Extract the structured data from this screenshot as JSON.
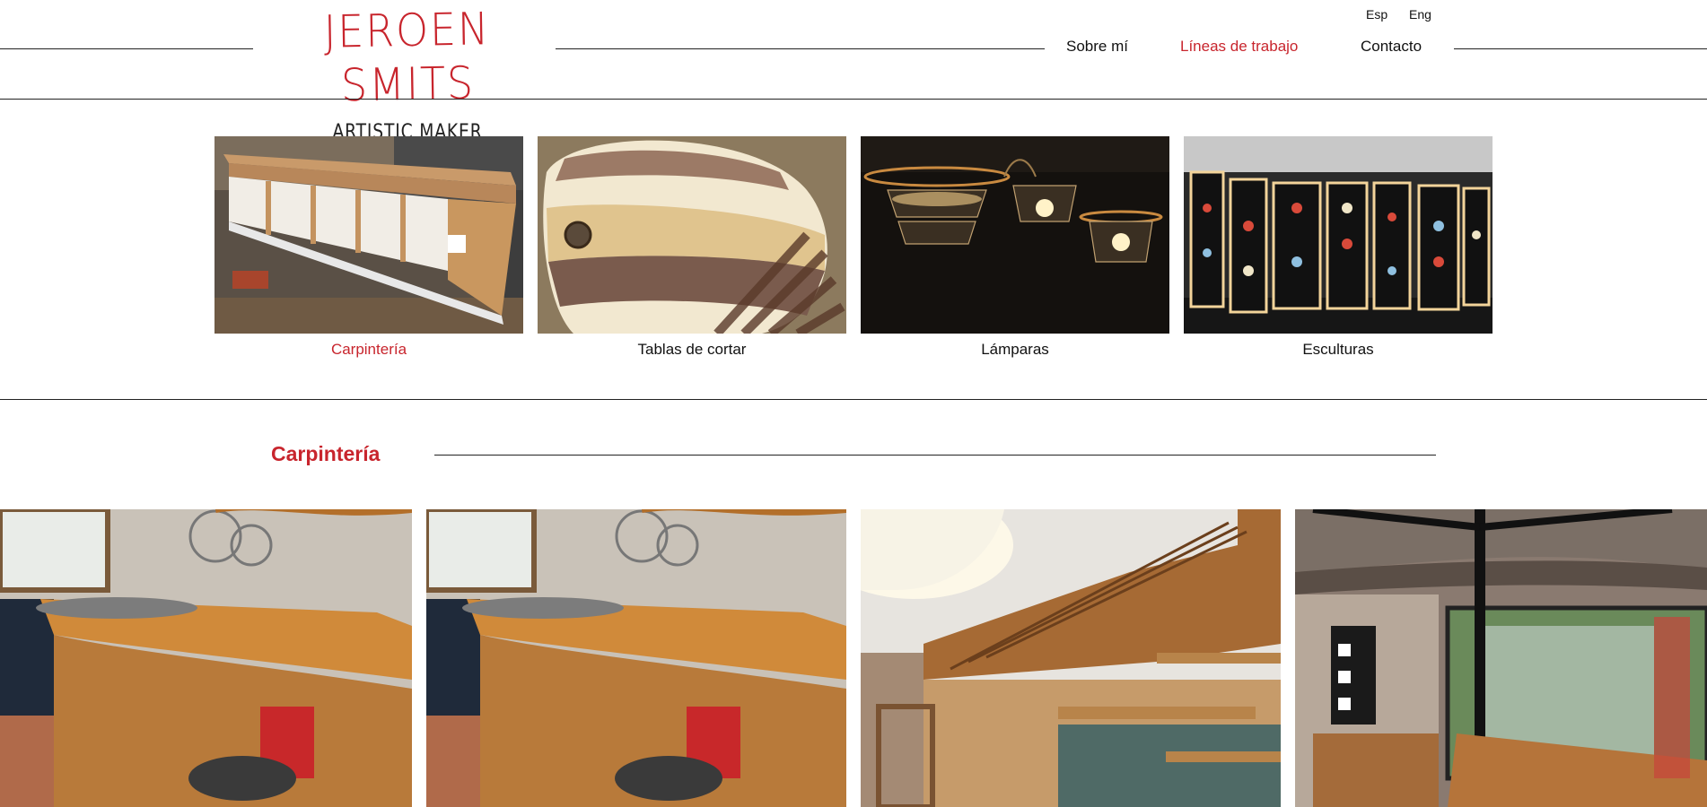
{
  "header": {
    "logo_title": "JEROEN SMITS",
    "logo_subtitle": "ARTISTIC MAKER",
    "languages": [
      {
        "label": "Esp"
      },
      {
        "label": "Eng"
      }
    ],
    "nav": [
      {
        "label": "Sobre mí",
        "active": false
      },
      {
        "label": "Líneas de trabajo",
        "active": true
      },
      {
        "label": "Contacto",
        "active": false
      }
    ]
  },
  "categories": [
    {
      "label": "Carpintería",
      "active": true
    },
    {
      "label": "Tablas de cortar",
      "active": false
    },
    {
      "label": "Lámparas",
      "active": false
    },
    {
      "label": "Esculturas",
      "active": false
    }
  ],
  "section": {
    "title": "Carpintería"
  },
  "colors": {
    "accent": "#c8252d",
    "text": "#111111",
    "line": "#222222",
    "background": "#ffffff"
  }
}
